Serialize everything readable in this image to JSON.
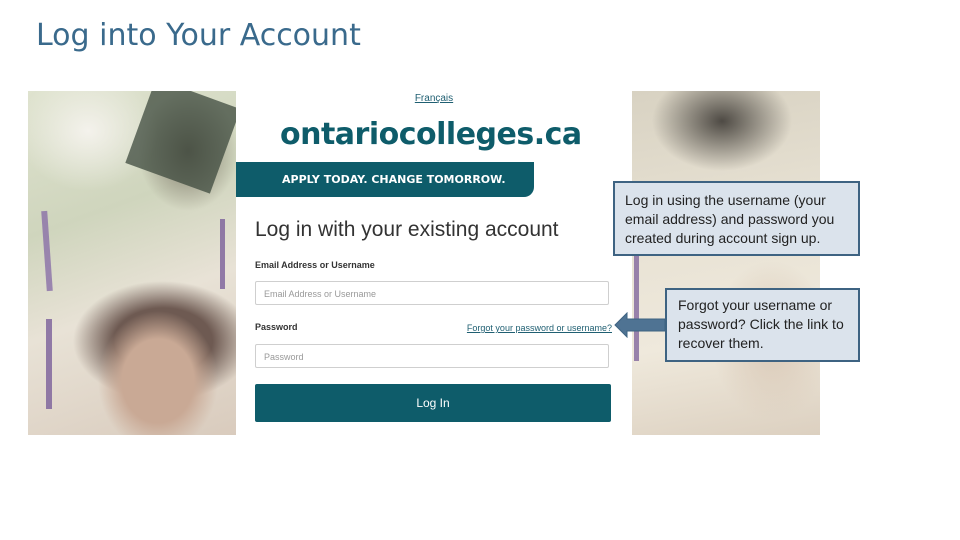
{
  "slide": {
    "title": "Log into Your Account"
  },
  "login_page": {
    "language_link": "Français",
    "brand": "ontariocolleges.ca",
    "tagline": "APPLY TODAY. CHANGE TOMORROW.",
    "heading": "Log in with your existing account",
    "email_label": "Email Address or Username",
    "email_placeholder": "Email Address or Username",
    "password_label": "Password",
    "password_placeholder": "Password",
    "forgot_link": "Forgot your password or username?",
    "login_button": "Log In",
    "colors": {
      "brand_teal": "#0e5c6a",
      "link": "#1f5f72"
    }
  },
  "callouts": {
    "login_tip": "Log in using the username (your  email address) and password you  created during account sign up.",
    "forgot_tip": "Forgot your username or  password? Click the link  to recover them.",
    "colors": {
      "fill": "#dbe3ec",
      "border": "#3e6382"
    }
  },
  "icons": {
    "arrow": "left-arrow-icon"
  }
}
